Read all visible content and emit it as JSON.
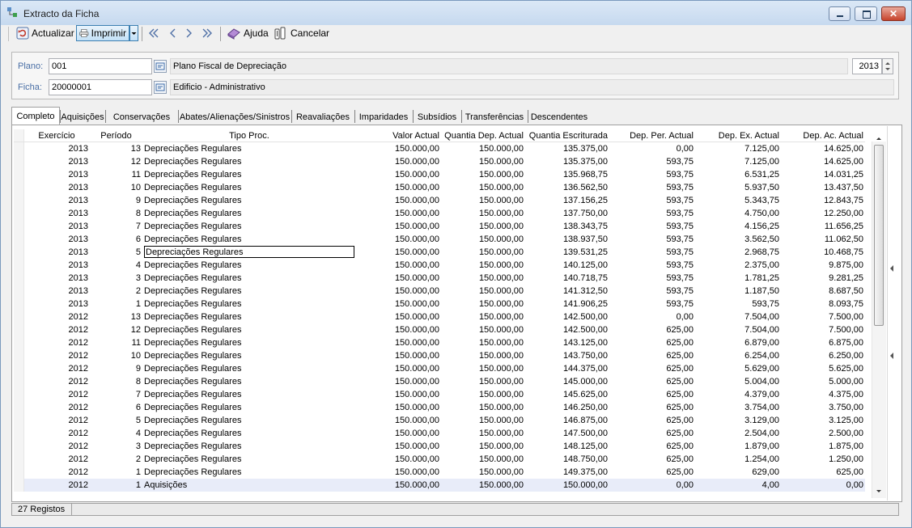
{
  "window": {
    "title": "Extracto da Ficha"
  },
  "toolbar": {
    "refresh_label": "Actualizar",
    "print_label": "Imprimir",
    "help_label": "Ajuda",
    "cancel_label": "Cancelar"
  },
  "form": {
    "plano_label": "Plano:",
    "plano_value": "001",
    "plano_desc": "Plano Fiscal de Depreciação",
    "year_value": "2013",
    "ficha_label": "Ficha:",
    "ficha_value": "20000001",
    "ficha_desc": "Edificio - Administrativo"
  },
  "tabs": [
    "Completo",
    "Aquisições",
    "Conservações",
    "Abates/Alienações/Sinistros",
    "Reavaliações",
    "Imparidades",
    "Subsídios",
    "Transferências",
    "Descendentes"
  ],
  "active_tab": "Completo",
  "columns": [
    "Exercício",
    "Período",
    "Tipo Proc.",
    "Valor Actual",
    "Quantia Dep. Actual",
    "Quantia Escriturada",
    "Dep. Per. Actual",
    "Dep. Ex. Actual",
    "Dep. Ac. Actual"
  ],
  "rows": [
    [
      "2013",
      "13",
      "Depreciações Regulares",
      "150.000,00",
      "150.000,00",
      "135.375,00",
      "0,00",
      "7.125,00",
      "14.625,00"
    ],
    [
      "2013",
      "12",
      "Depreciações Regulares",
      "150.000,00",
      "150.000,00",
      "135.375,00",
      "593,75",
      "7.125,00",
      "14.625,00"
    ],
    [
      "2013",
      "11",
      "Depreciações Regulares",
      "150.000,00",
      "150.000,00",
      "135.968,75",
      "593,75",
      "6.531,25",
      "14.031,25"
    ],
    [
      "2013",
      "10",
      "Depreciações Regulares",
      "150.000,00",
      "150.000,00",
      "136.562,50",
      "593,75",
      "5.937,50",
      "13.437,50"
    ],
    [
      "2013",
      "9",
      "Depreciações Regulares",
      "150.000,00",
      "150.000,00",
      "137.156,25",
      "593,75",
      "5.343,75",
      "12.843,75"
    ],
    [
      "2013",
      "8",
      "Depreciações Regulares",
      "150.000,00",
      "150.000,00",
      "137.750,00",
      "593,75",
      "4.750,00",
      "12.250,00"
    ],
    [
      "2013",
      "7",
      "Depreciações Regulares",
      "150.000,00",
      "150.000,00",
      "138.343,75",
      "593,75",
      "4.156,25",
      "11.656,25"
    ],
    [
      "2013",
      "6",
      "Depreciações Regulares",
      "150.000,00",
      "150.000,00",
      "138.937,50",
      "593,75",
      "3.562,50",
      "11.062,50"
    ],
    [
      "2013",
      "5",
      "Depreciações Regulares",
      "150.000,00",
      "150.000,00",
      "139.531,25",
      "593,75",
      "2.968,75",
      "10.468,75"
    ],
    [
      "2013",
      "4",
      "Depreciações Regulares",
      "150.000,00",
      "150.000,00",
      "140.125,00",
      "593,75",
      "2.375,00",
      "9.875,00"
    ],
    [
      "2013",
      "3",
      "Depreciações Regulares",
      "150.000,00",
      "150.000,00",
      "140.718,75",
      "593,75",
      "1.781,25",
      "9.281,25"
    ],
    [
      "2013",
      "2",
      "Depreciações Regulares",
      "150.000,00",
      "150.000,00",
      "141.312,50",
      "593,75",
      "1.187,50",
      "8.687,50"
    ],
    [
      "2013",
      "1",
      "Depreciações Regulares",
      "150.000,00",
      "150.000,00",
      "141.906,25",
      "593,75",
      "593,75",
      "8.093,75"
    ],
    [
      "2012",
      "13",
      "Depreciações Regulares",
      "150.000,00",
      "150.000,00",
      "142.500,00",
      "0,00",
      "7.504,00",
      "7.500,00"
    ],
    [
      "2012",
      "12",
      "Depreciações Regulares",
      "150.000,00",
      "150.000,00",
      "142.500,00",
      "625,00",
      "7.504,00",
      "7.500,00"
    ],
    [
      "2012",
      "11",
      "Depreciações Regulares",
      "150.000,00",
      "150.000,00",
      "143.125,00",
      "625,00",
      "6.879,00",
      "6.875,00"
    ],
    [
      "2012",
      "10",
      "Depreciações Regulares",
      "150.000,00",
      "150.000,00",
      "143.750,00",
      "625,00",
      "6.254,00",
      "6.250,00"
    ],
    [
      "2012",
      "9",
      "Depreciações Regulares",
      "150.000,00",
      "150.000,00",
      "144.375,00",
      "625,00",
      "5.629,00",
      "5.625,00"
    ],
    [
      "2012",
      "8",
      "Depreciações Regulares",
      "150.000,00",
      "150.000,00",
      "145.000,00",
      "625,00",
      "5.004,00",
      "5.000,00"
    ],
    [
      "2012",
      "7",
      "Depreciações Regulares",
      "150.000,00",
      "150.000,00",
      "145.625,00",
      "625,00",
      "4.379,00",
      "4.375,00"
    ],
    [
      "2012",
      "6",
      "Depreciações Regulares",
      "150.000,00",
      "150.000,00",
      "146.250,00",
      "625,00",
      "3.754,00",
      "3.750,00"
    ],
    [
      "2012",
      "5",
      "Depreciações Regulares",
      "150.000,00",
      "150.000,00",
      "146.875,00",
      "625,00",
      "3.129,00",
      "3.125,00"
    ],
    [
      "2012",
      "4",
      "Depreciações Regulares",
      "150.000,00",
      "150.000,00",
      "147.500,00",
      "625,00",
      "2.504,00",
      "2.500,00"
    ],
    [
      "2012",
      "3",
      "Depreciações Regulares",
      "150.000,00",
      "150.000,00",
      "148.125,00",
      "625,00",
      "1.879,00",
      "1.875,00"
    ],
    [
      "2012",
      "2",
      "Depreciações Regulares",
      "150.000,00",
      "150.000,00",
      "148.750,00",
      "625,00",
      "1.254,00",
      "1.250,00"
    ],
    [
      "2012",
      "1",
      "Depreciações Regulares",
      "150.000,00",
      "150.000,00",
      "149.375,00",
      "625,00",
      "629,00",
      "625,00"
    ],
    [
      "2012",
      "1",
      "Aquisições",
      "150.000,00",
      "150.000,00",
      "150.000,00",
      "0,00",
      "4,00",
      "0,00"
    ]
  ],
  "status": {
    "records": "27 Registos"
  },
  "colors": {
    "label": "#4a6fa5",
    "selected_row": "#e8ecf9",
    "print_hover": "#c4e1f7"
  }
}
